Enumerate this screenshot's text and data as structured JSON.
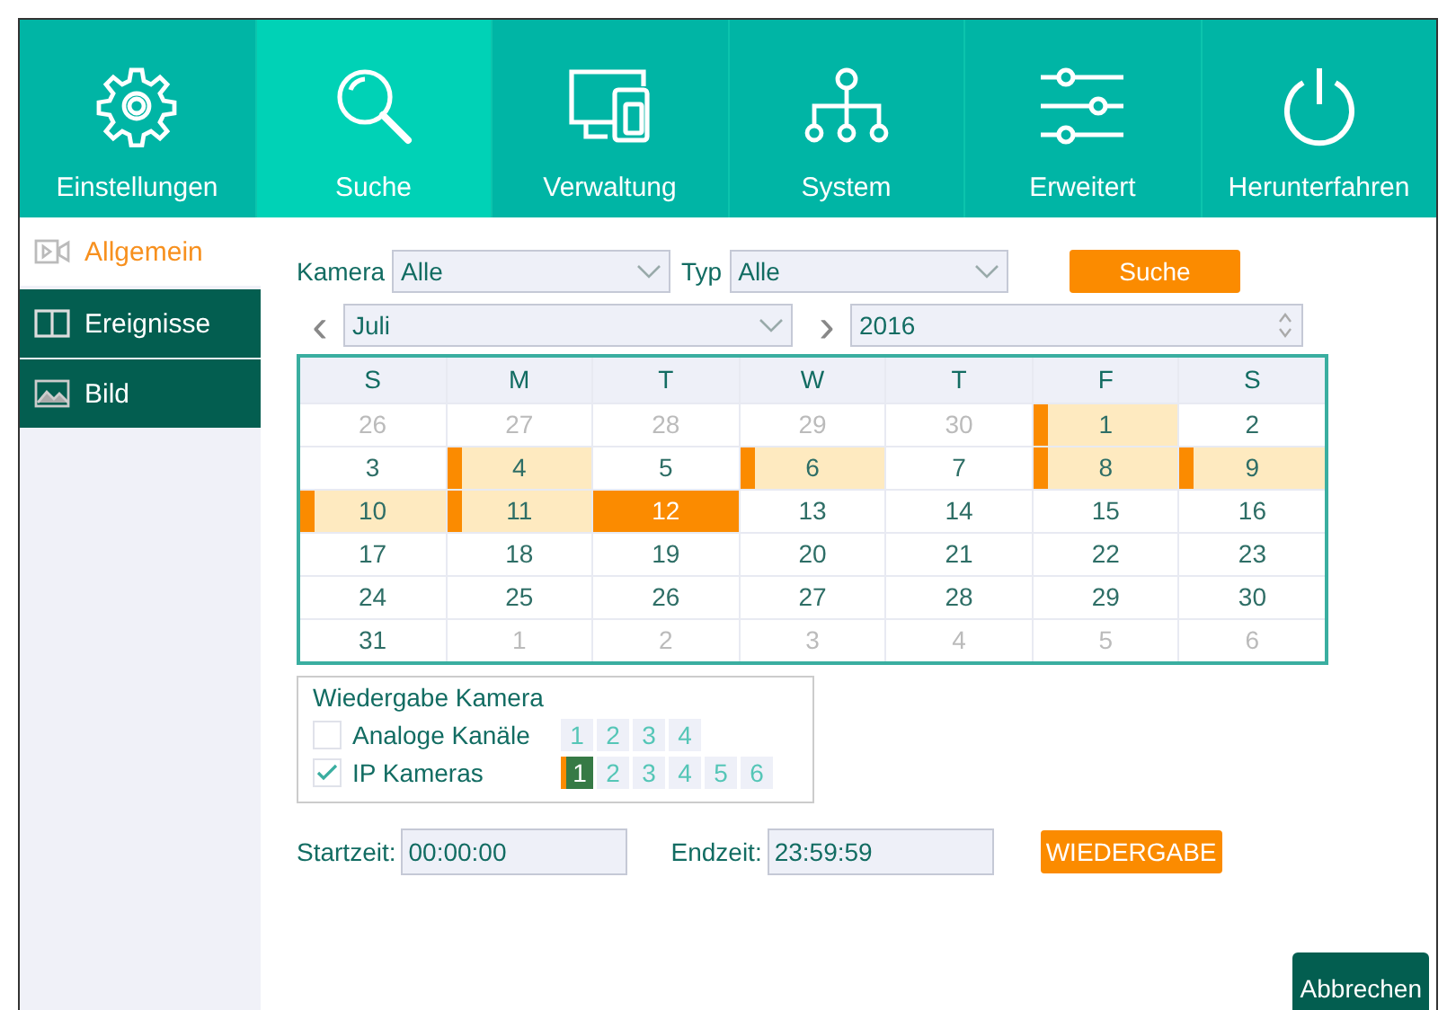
{
  "nav": [
    {
      "label": "Einstellungen",
      "kind": "gear",
      "selected": false
    },
    {
      "label": "Suche",
      "kind": "search",
      "selected": true
    },
    {
      "label": "Verwaltung",
      "kind": "devices",
      "selected": false
    },
    {
      "label": "System",
      "kind": "network",
      "selected": false
    },
    {
      "label": "Erweitert",
      "kind": "sliders",
      "selected": false
    },
    {
      "label": "Herunterfahren",
      "kind": "power",
      "selected": false
    }
  ],
  "sidebar": {
    "items": [
      {
        "label": "Allgemein",
        "kind": "video",
        "selected": true
      },
      {
        "label": "Ereignisse",
        "kind": "panel",
        "selected": false
      },
      {
        "label": "Bild",
        "kind": "image",
        "selected": false
      }
    ]
  },
  "filters": {
    "camera_label": "Kamera",
    "camera_value": "Alle",
    "type_label": "Typ",
    "type_value": "Alle",
    "search_button": "Suche"
  },
  "month_nav": {
    "prev": "‹",
    "month": "Juli",
    "next": "›",
    "year": "2016"
  },
  "calendar": {
    "weekdays": [
      "S",
      "M",
      "T",
      "W",
      "T",
      "F",
      "S"
    ],
    "days": [
      {
        "label": "26",
        "muted": true,
        "recorded": false,
        "selected": false
      },
      {
        "label": "27",
        "muted": true,
        "recorded": false,
        "selected": false
      },
      {
        "label": "28",
        "muted": true,
        "recorded": false,
        "selected": false
      },
      {
        "label": "29",
        "muted": true,
        "recorded": false,
        "selected": false
      },
      {
        "label": "30",
        "muted": true,
        "recorded": false,
        "selected": false
      },
      {
        "label": "1",
        "muted": false,
        "recorded": true,
        "selected": false
      },
      {
        "label": "2",
        "muted": false,
        "recorded": false,
        "selected": false
      },
      {
        "label": "3",
        "muted": false,
        "recorded": false,
        "selected": false
      },
      {
        "label": "4",
        "muted": false,
        "recorded": true,
        "selected": false
      },
      {
        "label": "5",
        "muted": false,
        "recorded": false,
        "selected": false
      },
      {
        "label": "6",
        "muted": false,
        "recorded": true,
        "selected": false
      },
      {
        "label": "7",
        "muted": false,
        "recorded": false,
        "selected": false
      },
      {
        "label": "8",
        "muted": false,
        "recorded": true,
        "selected": false
      },
      {
        "label": "9",
        "muted": false,
        "recorded": true,
        "selected": false
      },
      {
        "label": "10",
        "muted": false,
        "recorded": true,
        "selected": false
      },
      {
        "label": "11",
        "muted": false,
        "recorded": true,
        "selected": false
      },
      {
        "label": "12",
        "muted": false,
        "recorded": true,
        "selected": true
      },
      {
        "label": "13",
        "muted": false,
        "recorded": false,
        "selected": false
      },
      {
        "label": "14",
        "muted": false,
        "recorded": false,
        "selected": false
      },
      {
        "label": "15",
        "muted": false,
        "recorded": false,
        "selected": false
      },
      {
        "label": "16",
        "muted": false,
        "recorded": false,
        "selected": false
      },
      {
        "label": "17",
        "muted": false,
        "recorded": false,
        "selected": false
      },
      {
        "label": "18",
        "muted": false,
        "recorded": false,
        "selected": false
      },
      {
        "label": "19",
        "muted": false,
        "recorded": false,
        "selected": false
      },
      {
        "label": "20",
        "muted": false,
        "recorded": false,
        "selected": false
      },
      {
        "label": "21",
        "muted": false,
        "recorded": false,
        "selected": false
      },
      {
        "label": "22",
        "muted": false,
        "recorded": false,
        "selected": false
      },
      {
        "label": "23",
        "muted": false,
        "recorded": false,
        "selected": false
      },
      {
        "label": "24",
        "muted": false,
        "recorded": false,
        "selected": false
      },
      {
        "label": "25",
        "muted": false,
        "recorded": false,
        "selected": false
      },
      {
        "label": "26",
        "muted": false,
        "recorded": false,
        "selected": false
      },
      {
        "label": "27",
        "muted": false,
        "recorded": false,
        "selected": false
      },
      {
        "label": "28",
        "muted": false,
        "recorded": false,
        "selected": false
      },
      {
        "label": "29",
        "muted": false,
        "recorded": false,
        "selected": false
      },
      {
        "label": "30",
        "muted": false,
        "recorded": false,
        "selected": false
      },
      {
        "label": "31",
        "muted": false,
        "recorded": false,
        "selected": false
      },
      {
        "label": "1",
        "muted": true,
        "recorded": false,
        "selected": false
      },
      {
        "label": "2",
        "muted": true,
        "recorded": false,
        "selected": false
      },
      {
        "label": "3",
        "muted": true,
        "recorded": false,
        "selected": false
      },
      {
        "label": "4",
        "muted": true,
        "recorded": false,
        "selected": false
      },
      {
        "label": "5",
        "muted": true,
        "recorded": false,
        "selected": false
      },
      {
        "label": "6",
        "muted": true,
        "recorded": false,
        "selected": false
      }
    ]
  },
  "playback_camera": {
    "title": "Wiedergabe Kamera",
    "groups": [
      {
        "label": "Analoge Kanäle",
        "checked": false,
        "channels": [
          {
            "label": "1",
            "selected": false
          },
          {
            "label": "2",
            "selected": false
          },
          {
            "label": "3",
            "selected": false
          },
          {
            "label": "4",
            "selected": false
          }
        ]
      },
      {
        "label": "IP Kameras",
        "checked": true,
        "channels": [
          {
            "label": "1",
            "selected": true
          },
          {
            "label": "2",
            "selected": false
          },
          {
            "label": "3",
            "selected": false
          },
          {
            "label": "4",
            "selected": false
          },
          {
            "label": "5",
            "selected": false
          },
          {
            "label": "6",
            "selected": false
          }
        ]
      }
    ]
  },
  "times": {
    "start_label": "Startzeit:",
    "start_value": "00:00:00",
    "end_label": "Endzeit:",
    "end_value": "23:59:59",
    "playback_button": "WIEDERGABE"
  },
  "cancel_button": "Abbrechen"
}
